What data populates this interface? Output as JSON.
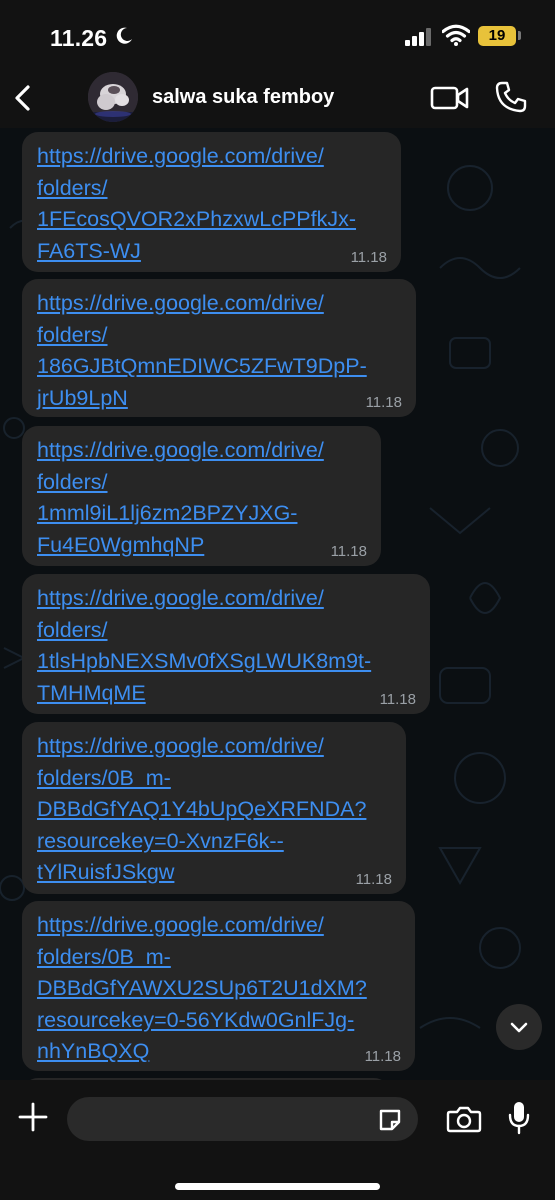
{
  "status_bar": {
    "time": "11.26",
    "battery": "19",
    "icons": [
      "moon-icon",
      "signal-icon",
      "wifi-icon",
      "battery-icon"
    ]
  },
  "header": {
    "contact_name": "salwa suka femboy",
    "icons": [
      "back-icon",
      "avatar",
      "video-call-icon",
      "phone-icon"
    ]
  },
  "messages": [
    {
      "text": "https://drive.google.com/drive/\nfolders/\n1FEcosQVOR2xPhzxwLcPPfkJx-\nFA6TS-WJ",
      "time": "11.18"
    },
    {
      "text": "https://drive.google.com/drive/\nfolders/\n186GJBtQmnEDIWC5ZFwT9DpP-\njrUb9LpN",
      "time": "11.18"
    },
    {
      "text": "https://drive.google.com/drive/\nfolders/\n1mml9iL1lj6zm2BPZYJXG-\nFu4E0WgmhqNP",
      "time": "11.18"
    },
    {
      "text": "https://drive.google.com/drive/\nfolders/\n1tlsHpbNEXSMv0fXSgLWUK8m9t-\nTMHMqME",
      "time": "11.18"
    },
    {
      "text": "https://drive.google.com/drive/\nfolders/0B_m-\nDBBdGfYAQ1Y4bUpQeXRFNDA?\nresourcekey=0-XvnzF6k--\ntYlRuisfJSkgw",
      "time": "11.18"
    },
    {
      "text": "https://drive.google.com/drive/\nfolders/0B_m-\nDBBdGfYAWXU2SUp6T2U1dXM?\nresourcekey=0-56YKdw0GnlFJg-\nnhYnBQXQ",
      "time": "11.18"
    }
  ],
  "input_bar": {
    "placeholder": "",
    "icons": [
      "plus-icon",
      "sticker-icon",
      "camera-icon",
      "mic-icon"
    ]
  },
  "colors": {
    "link": "#3d8ef0",
    "bubble": "#262626",
    "background": "#0b0f12",
    "bars": "#121212",
    "battery": "#e8c23a"
  }
}
